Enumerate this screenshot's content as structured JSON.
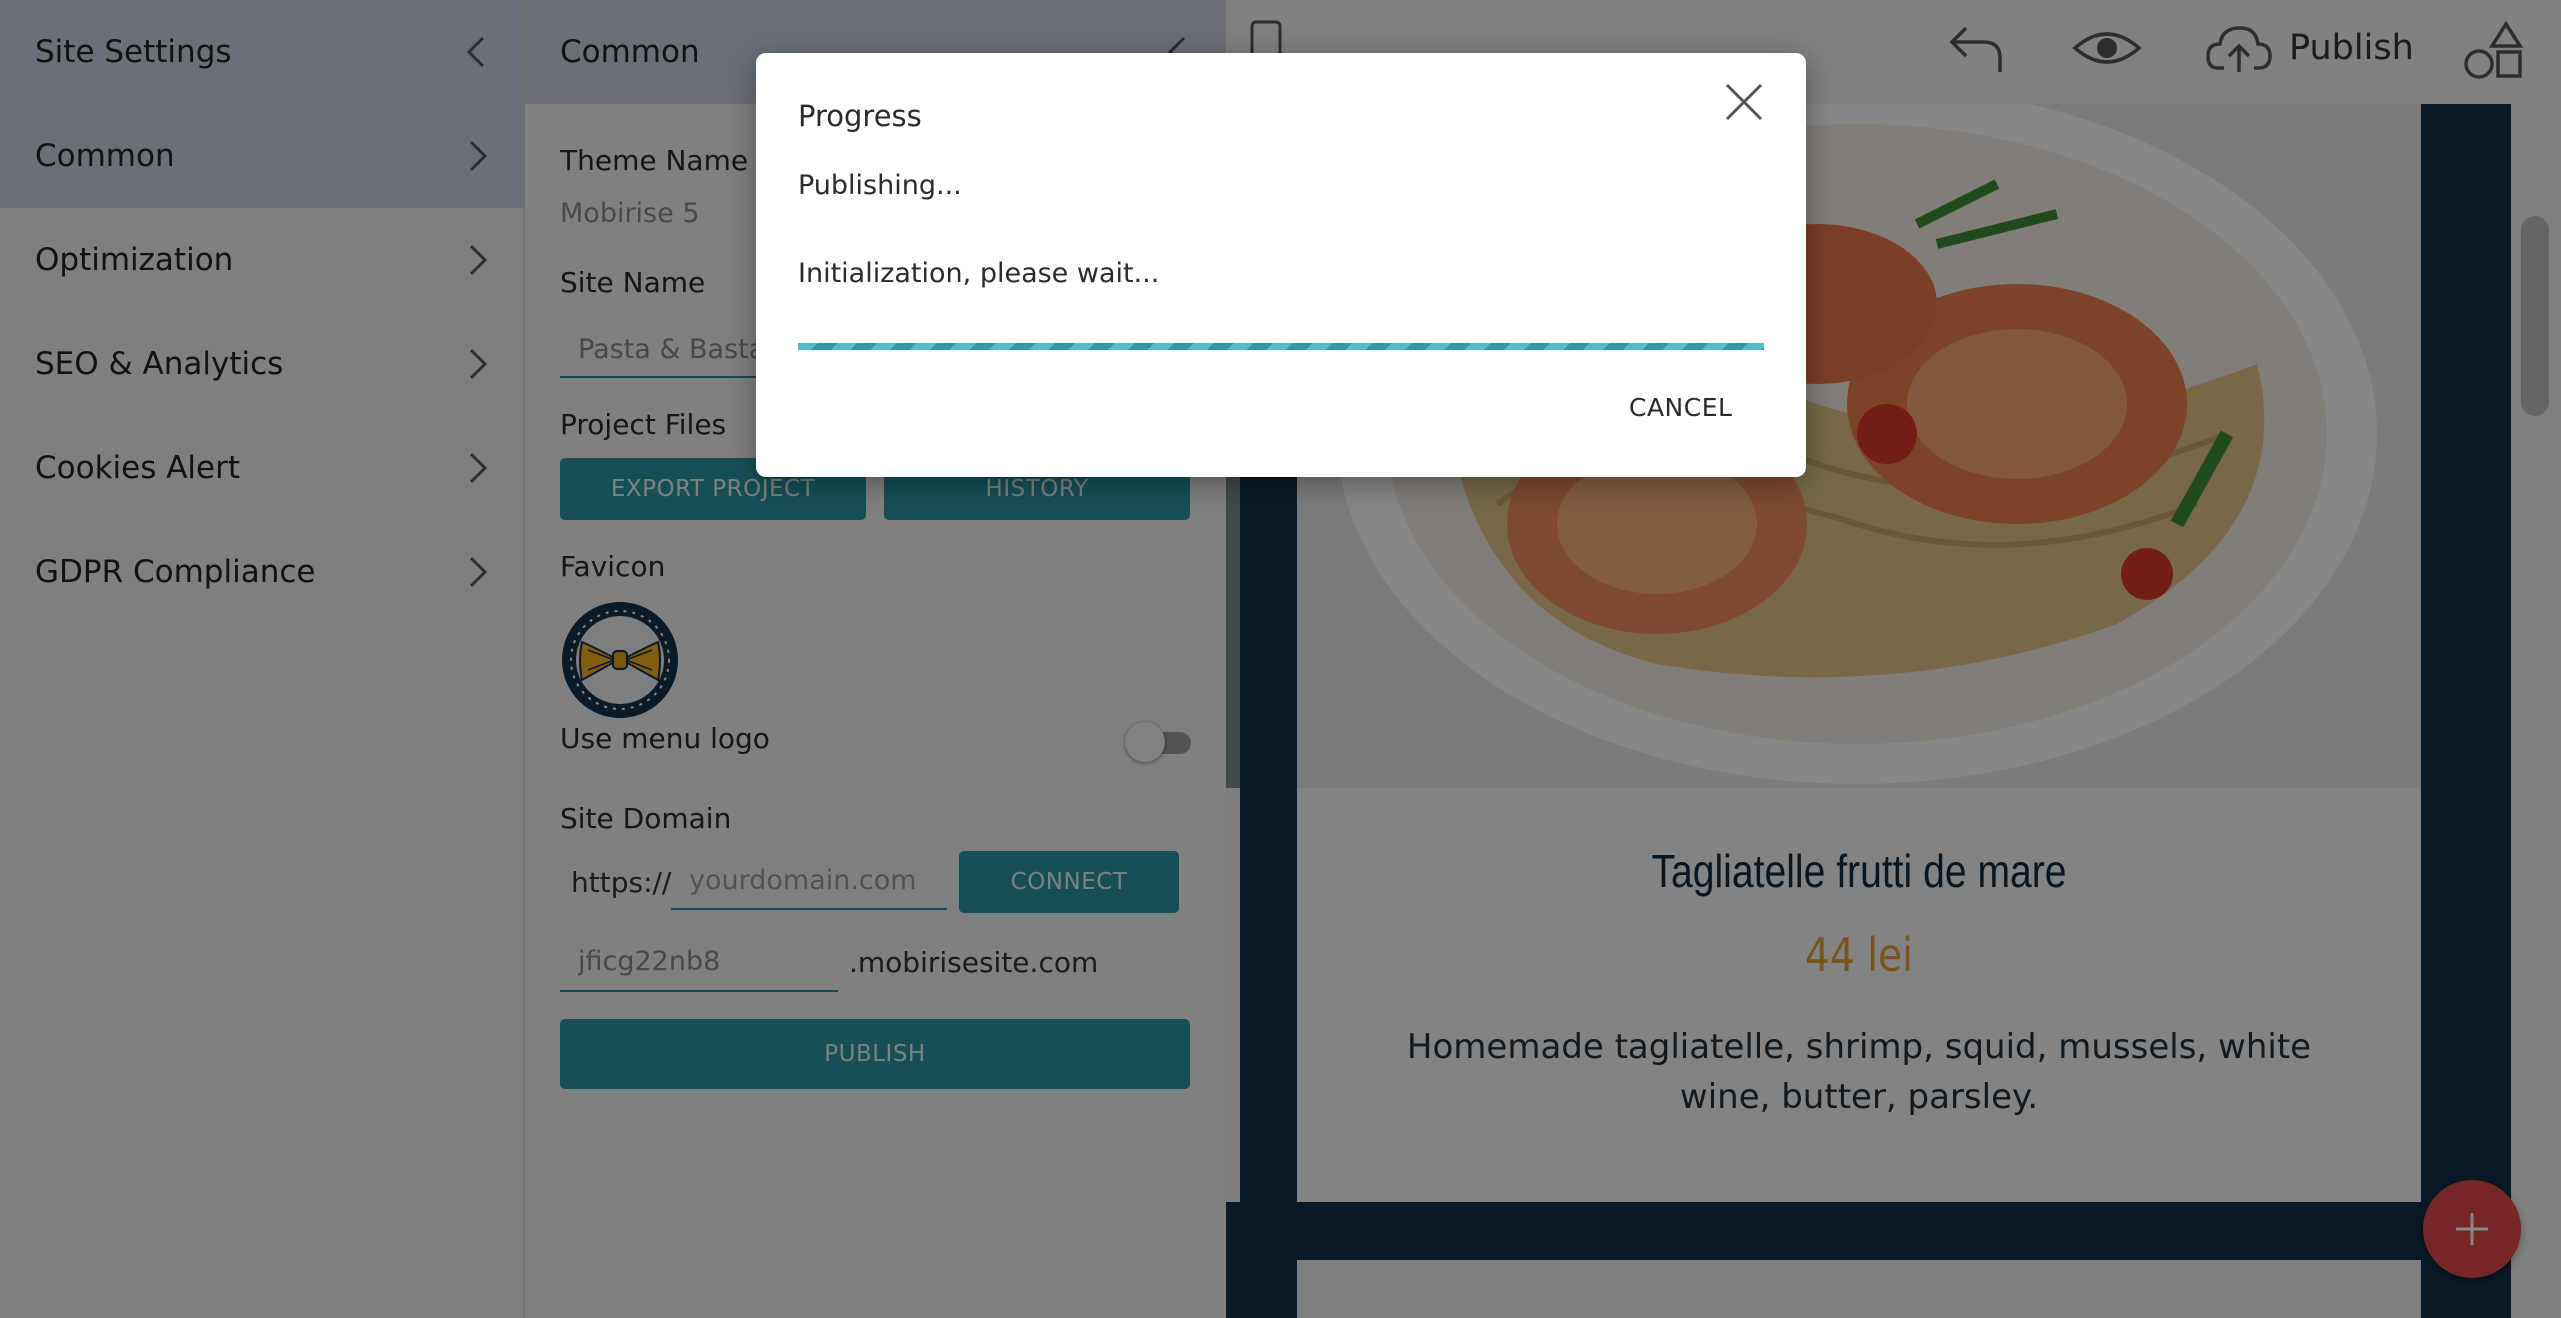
{
  "sidebar": {
    "title": "Site Settings",
    "items": [
      {
        "label": "Common"
      },
      {
        "label": "Optimization"
      },
      {
        "label": "SEO & Analytics"
      },
      {
        "label": "Cookies Alert"
      },
      {
        "label": "GDPR Compliance"
      }
    ]
  },
  "panel": {
    "title": "Common",
    "theme_name_label": "Theme Name",
    "theme_name_value": "Mobirise 5",
    "site_name_label": "Site Name",
    "site_name_value": "Pasta & Basta V",
    "project_files_label": "Project Files",
    "export_button": "EXPORT PROJECT",
    "history_button": "HISTORY",
    "favicon_label": "Favicon",
    "use_menu_logo_label": "Use menu logo",
    "use_menu_logo_on": false,
    "site_domain_label": "Site Domain",
    "domain_prefix": "https://",
    "domain_placeholder": "yourdomain.com",
    "connect_button": "CONNECT",
    "subdomain_value": "jficg22nb8",
    "subdomain_suffix": ".mobirisesite.com",
    "publish_button": "PUBLISH"
  },
  "topbar": {
    "publish_label": "Publish",
    "icons": [
      "mobile-view-icon",
      "undo-icon",
      "preview-eye-icon",
      "cloud-upload-icon",
      "blocks-shapes-icon"
    ]
  },
  "preview": {
    "dish_title": "Tagliatelle frutti de mare",
    "dish_price": "44 lei",
    "dish_description": "Homemade tagliatelle, shrimp, squid, mussels, white wine, butter, parsley."
  },
  "modal": {
    "title": "Progress",
    "status": "Publishing...",
    "message": "Initialization, please wait...",
    "cancel_label": "CANCEL"
  },
  "colors": {
    "accent": "#2b95a3",
    "price": "#e0a23a",
    "fab": "#e04848",
    "navy": "#11304a"
  }
}
